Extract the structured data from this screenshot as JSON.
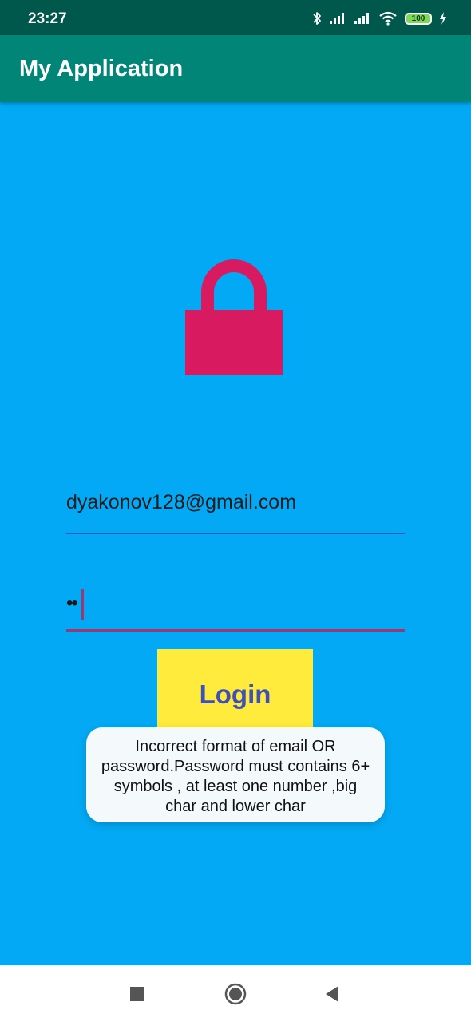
{
  "status_bar": {
    "time": "23:27",
    "battery_level": "100",
    "icons": [
      "bluetooth-icon",
      "signal-icon",
      "signal-icon",
      "wifi-icon",
      "battery-icon",
      "charging-icon"
    ]
  },
  "app_bar": {
    "title": "My Application"
  },
  "login_form": {
    "lock_icon": "lock-icon",
    "email_value": "dyakonov128@gmail.com",
    "password_value": "••",
    "login_label": "Login"
  },
  "toast": {
    "message": "Incorrect format of email OR password.Password must contains 6+ symbols , at least one number ,big char and lower char"
  },
  "nav_bar": {
    "icons": [
      "recents-icon",
      "home-icon",
      "back-icon"
    ]
  },
  "colors": {
    "status_bar": "#00574b",
    "app_bar": "#008577",
    "background": "#03a9f4",
    "lock": "#d81b60",
    "button": "#ffeb3b",
    "button_text": "#3f51b5",
    "accent": "#b0306a"
  }
}
